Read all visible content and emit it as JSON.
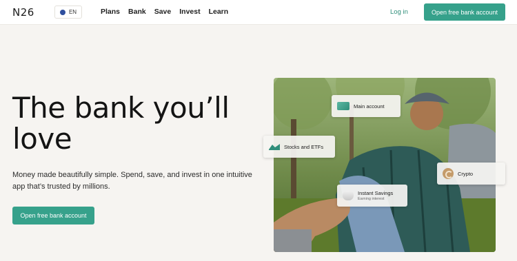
{
  "header": {
    "logo_text": "N26",
    "lang_label": "EN",
    "nav": [
      "Plans",
      "Bank",
      "Save",
      "Invest",
      "Learn"
    ],
    "login_label": "Log in",
    "cta_label": "Open free bank account"
  },
  "hero": {
    "headline_line1": "The bank you’ll",
    "headline_line2": "love",
    "subtitle": "Money made beautifully simple. Spend, save, and invest in one intuitive app that’s trusted by millions.",
    "cta_label": "Open free bank account"
  },
  "cards": {
    "main_account": "Main account",
    "stocks": "Stocks and ETFs",
    "crypto": "Crypto",
    "savings_title": "Instant Savings",
    "savings_sub": "Earning interest"
  },
  "colors": {
    "accent": "#36a18b",
    "background": "#f6f4f1",
    "link": "#2f8e7a"
  },
  "icons": [
    "globe-icon",
    "wallet-icon",
    "stocks-chart-icon",
    "crypto-coin-icon",
    "piggy-bank-icon"
  ]
}
